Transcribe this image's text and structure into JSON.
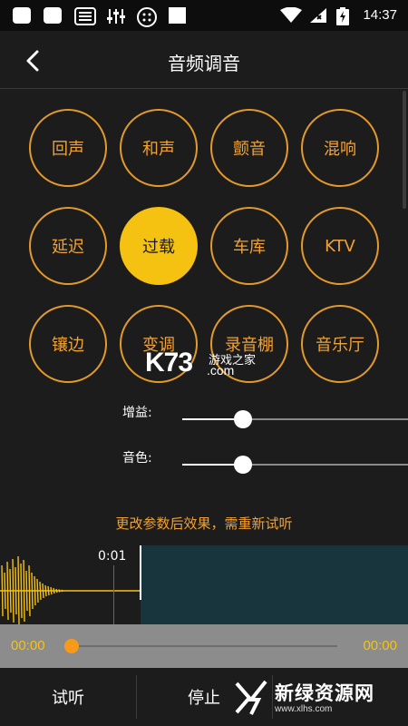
{
  "status_bar": {
    "time": "14:37"
  },
  "header": {
    "title": "音频调音"
  },
  "effects": [
    {
      "label": "回声",
      "active": false
    },
    {
      "label": "和声",
      "active": false
    },
    {
      "label": "颤音",
      "active": false
    },
    {
      "label": "混响",
      "active": false
    },
    {
      "label": "延迟",
      "active": false
    },
    {
      "label": "过载",
      "active": true
    },
    {
      "label": "车库",
      "active": false
    },
    {
      "label": "KTV",
      "active": false
    },
    {
      "label": "镶边",
      "active": false
    },
    {
      "label": "变调",
      "active": false
    },
    {
      "label": "录音棚",
      "active": false
    },
    {
      "label": "音乐厅",
      "active": false
    }
  ],
  "watermark": {
    "brand": "K73",
    "subtitle": "游戏之家",
    "domain": ".com"
  },
  "sliders": {
    "gain": {
      "label": "增益:",
      "value_fraction": 0.27
    },
    "tone": {
      "label": "音色:",
      "value_fraction": 0.27
    }
  },
  "notice": "更改参数后效果，需重新试听",
  "waveform": {
    "time_mark": "0:01"
  },
  "player": {
    "current_time": "00:00",
    "total_time": "00:00",
    "progress_fraction": 0.0
  },
  "bottom_bar": {
    "preview_label": "试听",
    "stop_label": "停止"
  },
  "site_logo": {
    "name": "新绿资源网",
    "url": "www.xlhs.com"
  },
  "colors": {
    "accent": "#f0a236",
    "active": "#f6c212",
    "wave": "#f6c212",
    "background": "#1c1c1c"
  }
}
